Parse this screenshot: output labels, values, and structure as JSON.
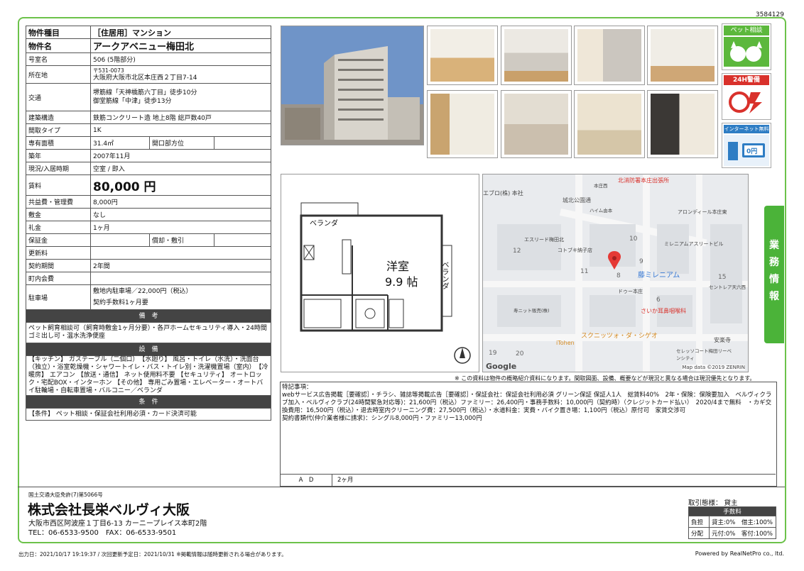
{
  "doc_id": "3584129",
  "property": {
    "type_label": "物件種目",
    "type_value": "［住居用］マンション",
    "name_label": "物件名",
    "name_value": "アークアベニュー梅田北",
    "room_label": "号室名",
    "room_value": "506 (5階部分)",
    "addr_label": "所在地",
    "zip": "〒531-0073",
    "address": "大阪府大阪市北区本庄西２丁目7-14",
    "traffic_label": "交通",
    "traffic_1": "堺筋線「天神橋筋六丁目」徒歩10分",
    "traffic_2": "御堂筋線「中津」徒歩13分",
    "struct_label": "建築構造",
    "struct_value": "鉄筋コンクリート造 地上8階 総戸数40戸",
    "layout_label": "間取タイプ",
    "layout_value": "1K",
    "area_label": "専有面積",
    "area_value": "31.4㎡",
    "orient_label": "開口部方位",
    "built_label": "築年",
    "built_value": "2007年11月",
    "status_label": "現況/入居時期",
    "status_value": "空室 / 即入",
    "rent_label": "賃料",
    "rent_value": "80,000 円",
    "common_label": "共益費・管理費",
    "common_value": "8,000円",
    "deposit_label": "敷金",
    "deposit_value": "なし",
    "key_label": "礼金",
    "key_value": "1ヶ月",
    "guarantee_label": "保証金",
    "shikibiki_label": "償却・敷引",
    "renewal_label": "更新料",
    "contract_label": "契約期間",
    "contract_value": "2年間",
    "town_label": "町内会費",
    "parking_label": "駐車場",
    "parking_1": "敷地内駐車場／22,000円（税込）",
    "parking_2": "契約手数料1ヶ月要"
  },
  "remarks": {
    "header": "備　考",
    "text": "ペット飼育相談可（飼育時敷金1ヶ月分要）・各戸ホームセキュリティ導入・24時間ゴミ出し可・温水洗浄便座"
  },
  "equipment": {
    "header": "設　備",
    "text": "【キッチン】 ガステーブル（二個口）　【水廻り】 風呂・トイレ（水洗）・洗面台（独立）・浴室乾燥機・シャワートイレ・バス・トイレ別・洗濯機置場（室内）　【冷暖房】 エアコン 【放送・通信】 ネット使用料不要 【セキュリティ】 オートロック・宅配BOX・インターホン 【その他】 専用ごみ置場・エレベーター・オートバイ駐輪場・自転車置場・バルコニー／ベランダ"
  },
  "conditions": {
    "header": "条　件",
    "text": "【条件】 ペット相談・保証会社利用必須・カード決済可能"
  },
  "badges": {
    "pet": "ペット相談",
    "security": "24H警備",
    "internet": "インターネット無料",
    "internet_price": "0円"
  },
  "floorplan": {
    "veranda_top": "ベランダ",
    "veranda_side": "ベランダ",
    "room_name": "洋室",
    "room_size": "9.9 帖"
  },
  "map": {
    "labels": [
      "北消防署本庄出張所",
      "アロンディール本庄東",
      "エスリード梅田北",
      "コトブキ納子店",
      "ミレニアムアスリートビル",
      "藤ミレニアム",
      "ドゥー本庄",
      "さいか耳鼻咽喉科",
      "スクニッツォ・ダ・シゲオ",
      "セレッソコート梅田リーベンシティ",
      "安楽寺",
      "iTohen",
      "セントレア天六西",
      "寿ニット販売(株)",
      "ハイム由本",
      "城北公園通",
      "エブロ(株) 本社",
      "本庄西"
    ],
    "block_numbers": [
      "12",
      "11",
      "10",
      "9",
      "8",
      "6",
      "15",
      "19",
      "20"
    ],
    "attribution": "Map data ©2019 ZENRIN",
    "google": "Google"
  },
  "disclaimer": "※ この資料は物件の概略紹介資料になります。間取図面、設備、概要などが現況と異なる場合は現況優先となります。",
  "special": {
    "title": "特記事項：",
    "lines": [
      "webサービス広告掲載［要確認］・チラシ、雑誌等掲載広告［要確認］・保証会社：保証会社利用必須 グリーン保証 保証人1人　総賃料40%　2年・保険：保険要加入　ベルヴィクラブ加入・ベルヴィクラブ(24時間緊急対応等)：21,600円（税込）ファミリー：26,400円・事務手数料：10,000円（契約時）（クレジットカード払い）　2020/4まで無料　・カギ交換費用：16,500円（税込）・退去時室内クリーニング費：27,500円（税込）・水道料金：実費・バイク置き場：1,100円（税込）原付可　家賃交渉可",
      "契約書類代(仲介業者様に請求)：シングル8,000円・ファミリー13,000円"
    ]
  },
  "ad": {
    "label": "A　D",
    "value": "2ヶ月"
  },
  "side_tab": [
    "業",
    "務",
    "情",
    "報"
  ],
  "company": {
    "license": "国土交通大臣免許(7)第5066号",
    "name": "株式会社長栄ベルヴィ大阪",
    "address": "大阪市西区阿波座１丁目6-13 カーニープレイス本町2階",
    "contact": "TEL：06-6533-9500　FAX：06-6533-9501"
  },
  "fees": {
    "transaction_label": "取引態様：",
    "transaction_value": "貸主",
    "header": "手数料",
    "burden_label": "負担",
    "burden_value": "貸主:0%　借主:100%",
    "split_label": "分配",
    "split_value": "元付:0%　客付:100%"
  },
  "footer": {
    "left": "出力日：2021/10/17 19:19:37 / 次回更新予定日：2021/10/31 ※掲載情報は随時更新される場合があります。",
    "right": "Powered by RealNetPro co., ltd."
  },
  "colors": {
    "accent": "#4bb339",
    "header_dark": "#444444",
    "pin": "#e53935"
  }
}
